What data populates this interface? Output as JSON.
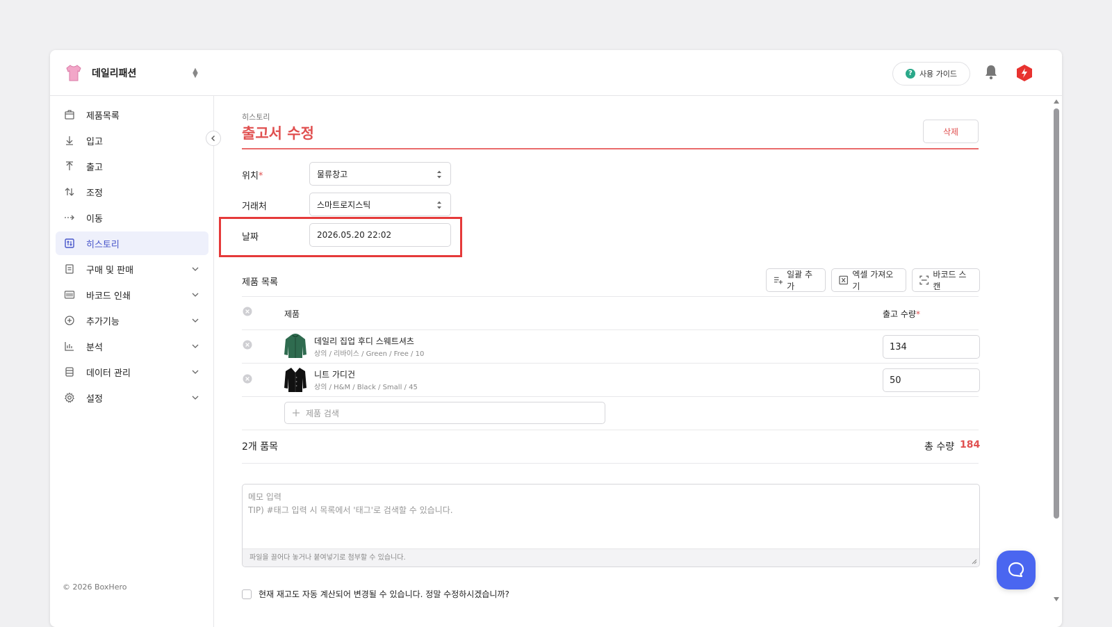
{
  "brand": {
    "name": "데일리패션"
  },
  "header": {
    "guide_label": "사용 가이드"
  },
  "sidebar": {
    "items": [
      {
        "label": "제품목록",
        "icon": "box-icon"
      },
      {
        "label": "입고",
        "icon": "arrow-down-icon"
      },
      {
        "label": "출고",
        "icon": "arrow-up-icon"
      },
      {
        "label": "조정",
        "icon": "swap-icon"
      },
      {
        "label": "이동",
        "icon": "move-icon"
      },
      {
        "label": "히스토리",
        "icon": "history-icon",
        "active": true
      },
      {
        "label": "구매 및 판매",
        "icon": "document-icon",
        "expandable": true
      },
      {
        "label": "바코드 인쇄",
        "icon": "barcode-icon",
        "expandable": true
      },
      {
        "label": "추가기능",
        "icon": "plus-circle-icon",
        "expandable": true
      },
      {
        "label": "분석",
        "icon": "chart-icon",
        "expandable": true
      },
      {
        "label": "데이터 관리",
        "icon": "database-icon",
        "expandable": true
      },
      {
        "label": "설정",
        "icon": "gear-icon",
        "expandable": true
      }
    ],
    "copyright": "© 2026 BoxHero"
  },
  "page": {
    "breadcrumb": "히스토리",
    "title": "출고서 수정",
    "delete_label": "삭제"
  },
  "form": {
    "location_label": "위치",
    "location_value": "물류창고",
    "partner_label": "거래처",
    "partner_value": "스마트로지스틱",
    "date_label": "날짜",
    "date_value": "2026.05.20 22:02"
  },
  "products": {
    "section_title": "제품 목록",
    "bulk_add": "일괄 추가",
    "excel_import": "엑셀 가져오기",
    "barcode_scan": "바코드 스캔",
    "col_product": "제품",
    "col_qty": "출고 수량",
    "rows": [
      {
        "name": "데일리 집업 후디 스웨트셔츠",
        "meta": "상의 / 리바이스 / Green / Free / 10",
        "qty": "134"
      },
      {
        "name": "니트 가디건",
        "meta": "상의 / H&M / Black / Small / 45",
        "qty": "50"
      }
    ],
    "search_placeholder": "제품 검색",
    "count_label": "2개 품목",
    "total_label": "총 수량",
    "total_value": "184"
  },
  "memo": {
    "placeholder_line1": "메모 입력",
    "placeholder_line2": "TIP) #태그 입력 시 목록에서 '태그'로 검색할 수 있습니다.",
    "attach_hint": "파일을 끌어다 놓거나 붙여넣기로 첨부할 수 있습니다."
  },
  "confirm_text": "현재 재고도 자동 계산되어 변경될 수 있습니다. 정말 수정하시겠습니까?",
  "colors": {
    "accent_red": "#e05050",
    "active_blue": "#4654c9",
    "chat_blue": "#4a66f0"
  }
}
